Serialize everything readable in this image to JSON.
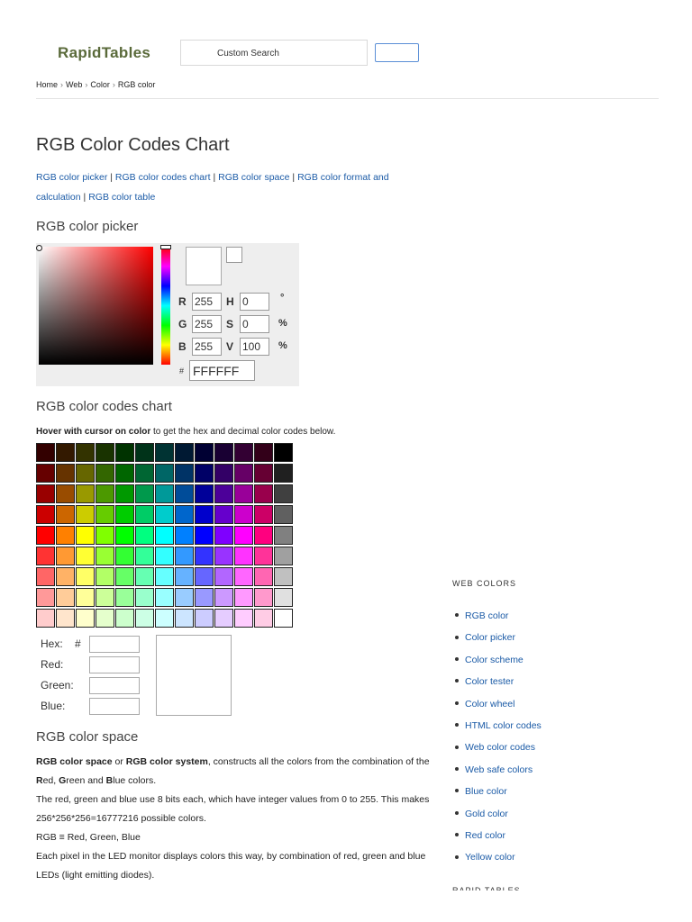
{
  "header": {
    "logo": "RapidTables",
    "search_placeholder": "Custom Search",
    "breadcrumb": [
      "Home",
      "Web",
      "Color",
      "RGB color"
    ]
  },
  "page": {
    "title": "RGB Color Codes Chart",
    "toc": [
      "RGB color picker",
      "RGB color codes chart",
      "RGB color space",
      "RGB color format and calculation",
      "RGB color table"
    ]
  },
  "picker": {
    "heading": "RGB color picker",
    "fields": [
      {
        "label": "R",
        "value": "255",
        "label2": "H",
        "value2": "0",
        "unit": "°"
      },
      {
        "label": "G",
        "value": "255",
        "label2": "S",
        "value2": "0",
        "unit": "%"
      },
      {
        "label": "B",
        "value": "255",
        "label2": "V",
        "value2": "100",
        "unit": "%"
      }
    ],
    "hash": "#",
    "hex": "FFFFFF",
    "preview_color": "#ffffff"
  },
  "chart": {
    "heading": "RGB color codes chart",
    "note_bold": "Hover with cursor on color",
    "note_rest": " to get the hex and decimal color codes below.",
    "rows": [
      [
        "#330000",
        "#331900",
        "#333300",
        "#193300",
        "#003300",
        "#003319",
        "#003333",
        "#001933",
        "#000033",
        "#190033",
        "#330033",
        "#330019",
        "#000000"
      ],
      [
        "#660000",
        "#663300",
        "#666600",
        "#336600",
        "#006600",
        "#006633",
        "#006666",
        "#003366",
        "#000066",
        "#330066",
        "#660066",
        "#660033",
        "#202020"
      ],
      [
        "#990000",
        "#994c00",
        "#999900",
        "#4c9900",
        "#009900",
        "#00994c",
        "#009999",
        "#004c99",
        "#000099",
        "#4c0099",
        "#990099",
        "#99004c",
        "#404040"
      ],
      [
        "#cc0000",
        "#cc6600",
        "#cccc00",
        "#66cc00",
        "#00cc00",
        "#00cc66",
        "#00cccc",
        "#0066cc",
        "#0000cc",
        "#6600cc",
        "#cc00cc",
        "#cc0066",
        "#606060"
      ],
      [
        "#ff0000",
        "#ff8000",
        "#ffff00",
        "#80ff00",
        "#00ff00",
        "#00ff80",
        "#00ffff",
        "#0080ff",
        "#0000ff",
        "#7f00ff",
        "#ff00ff",
        "#ff007f",
        "#808080"
      ],
      [
        "#ff3333",
        "#ff9933",
        "#ffff33",
        "#99ff33",
        "#33ff33",
        "#33ff99",
        "#33ffff",
        "#3399ff",
        "#3333ff",
        "#9933ff",
        "#ff33ff",
        "#ff3399",
        "#a0a0a0"
      ],
      [
        "#ff6666",
        "#ffb266",
        "#ffff66",
        "#b2ff66",
        "#66ff66",
        "#66ffb2",
        "#66ffff",
        "#66b2ff",
        "#6666ff",
        "#b266ff",
        "#ff66ff",
        "#ff66b2",
        "#c0c0c0"
      ],
      [
        "#ff9999",
        "#ffcc99",
        "#ffff99",
        "#ccff99",
        "#99ff99",
        "#99ffcc",
        "#99ffff",
        "#99ccff",
        "#9999ff",
        "#cc99ff",
        "#ff99ff",
        "#ff99cc",
        "#e0e0e0"
      ],
      [
        "#ffcccc",
        "#ffe5cc",
        "#ffffcc",
        "#e5ffcc",
        "#ccffcc",
        "#ccffe5",
        "#ccffff",
        "#cce5ff",
        "#ccccff",
        "#e5ccff",
        "#ffccff",
        "#ffcce5",
        "#ffffff"
      ]
    ],
    "lookup": {
      "hex_label": "Hex:",
      "hash": "#",
      "red_label": "Red:",
      "green_label": "Green:",
      "blue_label": "Blue:"
    }
  },
  "space": {
    "heading": "RGB color space",
    "p1_b1": "RGB color space",
    "p1_t1": " or ",
    "p1_b2": "RGB color system",
    "p1_t2": ", constructs all the colors from the combination of the ",
    "p1_r": "R",
    "p1_t3": "ed, ",
    "p1_g": "G",
    "p1_t4": "reen and ",
    "p1_bl": "B",
    "p1_t5": "lue colors.",
    "p2": "The red, green and blue use 8 bits each, which have integer values from 0 to 255. This makes 256*256*256=16777216 possible colors.",
    "p3": "RGB ≡ Red, Green, Blue",
    "p4": "Each pixel in the LED monitor displays colors this way, by combination of red, green and blue LEDs (light emitting diodes)."
  },
  "sidebar": {
    "heading": "WEB COLORS",
    "items": [
      "RGB color",
      "Color picker",
      "Color scheme",
      "Color tester",
      "Color wheel",
      "HTML color codes",
      "Web color codes",
      "Web safe colors",
      "Blue color",
      "Gold color",
      "Red color",
      "Yellow color"
    ],
    "heading2": "RAPID TABLES"
  }
}
